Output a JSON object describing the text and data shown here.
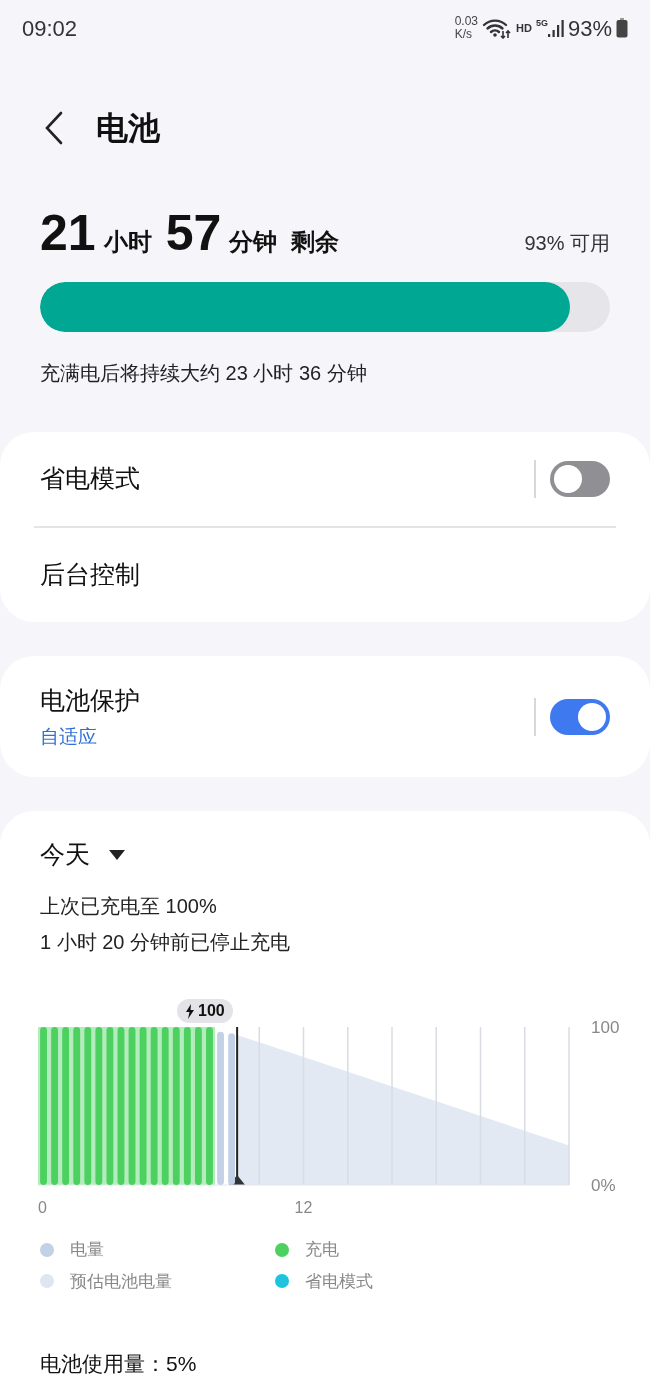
{
  "status_bar": {
    "time": "09:02",
    "net_speed": [
      "0.03",
      "K/s"
    ],
    "network": "HD",
    "cellular": "5G",
    "battery": "93%"
  },
  "header": {
    "title": "电池"
  },
  "summary": {
    "remaining": [
      {
        "value": "21",
        "unit": "小时"
      },
      {
        "value": "57",
        "unit": "分钟"
      }
    ],
    "suffix": "剩余",
    "available": "93% 可用",
    "level": 0.93,
    "note": "充满电后将持续大约 23 小时 36 分钟"
  },
  "settings_groups": [
    {
      "items": [
        {
          "label": "省电模式",
          "kind": "toggle",
          "on": false
        },
        {
          "label": "后台控制",
          "kind": "link"
        }
      ]
    },
    {
      "items": [
        {
          "label": "电池保护",
          "subtitle": "自适应",
          "kind": "toggle",
          "on": true
        }
      ]
    }
  ],
  "usage": {
    "period": "今天",
    "lines": [
      "上次已充电至 100%",
      "1 小时 20 分钟前已停止充电"
    ],
    "badge": "100",
    "chart_data": {
      "type": "bar",
      "x": [
        0,
        0.5,
        1,
        1.5,
        2,
        2.5,
        3,
        3.5,
        4,
        4.5,
        5,
        5.5,
        6,
        6.5,
        7,
        7.5,
        8,
        8.5
      ],
      "series": [
        {
          "name": "电量",
          "color": "#c3d1e6",
          "values": [
            null,
            null,
            null,
            null,
            null,
            null,
            null,
            null,
            null,
            null,
            null,
            null,
            null,
            null,
            null,
            null,
            97,
            96
          ]
        },
        {
          "name": "充电",
          "color": "#4cd05f",
          "values": [
            100,
            100,
            100,
            100,
            100,
            100,
            100,
            100,
            100,
            100,
            100,
            100,
            100,
            100,
            100,
            100,
            null,
            null
          ]
        },
        {
          "name": "预估电池电量",
          "color": "#dde6f1",
          "values": [
            null,
            null,
            null,
            null,
            null,
            null,
            null,
            null,
            null,
            null,
            null,
            null,
            null,
            null,
            null,
            null,
            null,
            null
          ]
        },
        {
          "name": "省电模式",
          "color": "#1ec4dd",
          "values": [
            null,
            null,
            null,
            null,
            null,
            null,
            null,
            null,
            null,
            null,
            null,
            null,
            null,
            null,
            null,
            null,
            null,
            null
          ]
        }
      ],
      "xlim": [
        0,
        24
      ],
      "ylim": [
        0,
        100
      ],
      "xticks": [
        0,
        12
      ],
      "yticks": [
        {
          "value": 100,
          "label": "100"
        },
        {
          "value": 0,
          "label": "0%"
        }
      ]
    },
    "usage_total": "电池使用量：5%"
  }
}
